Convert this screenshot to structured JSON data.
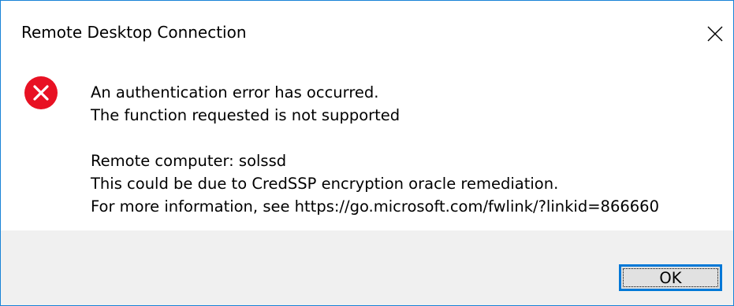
{
  "window": {
    "title": "Remote Desktop Connection",
    "close_icon": "close-icon"
  },
  "message": {
    "icon": "error-icon",
    "icon_color": "#e81123",
    "line1": "An authentication error has occurred.",
    "line2": "The function requested is not supported",
    "line3": "Remote computer: solssd",
    "line4": "This could be due to CredSSP encryption oracle remediation.",
    "line5": "For more information, see https://go.microsoft.com/fwlink/?linkid=866660"
  },
  "buttons": {
    "ok_label": "OK"
  },
  "colors": {
    "accent": "#0078d7",
    "footer_bg": "#f0f0f0"
  }
}
